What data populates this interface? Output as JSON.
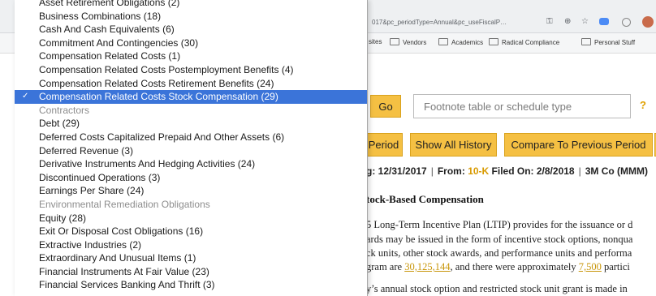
{
  "browser": {
    "url_fragment": "017&pc_periodType=Annual&pc_useFiscalP…",
    "bookmarks": [
      {
        "label": "sites",
        "folder": false
      },
      {
        "label": "Vendors",
        "folder": true
      },
      {
        "label": "Academics",
        "folder": true
      },
      {
        "label": "Radical Compliance",
        "folder": true
      },
      {
        "label": "Personal Stuff",
        "folder": true
      }
    ]
  },
  "search": {
    "go_label": "Go",
    "placeholder": "Footnote table or schedule type",
    "help_label": "?"
  },
  "period_buttons": {
    "period": "Period",
    "show_all_history": "Show All History",
    "compare": "Compare To Previous Period"
  },
  "filing": {
    "date_fragment": "g: 12/31/2017",
    "from_label": "From:",
    "form": "10-K",
    "filed_label": "Filed On: 2/8/2018",
    "company": "3M Co (MMM)"
  },
  "document": {
    "heading": "tock-Based Compensation",
    "line1": "5 Long-Term Incentive Plan (LTIP) provides for the issuance or d",
    "line2": "ards may be issued in the form of incentive stock options, nonqua",
    "line3": "ck units, other stock awards, and performance units and performa",
    "line4_pre": "gram are ",
    "line4_link1": "30,125,144",
    "line4_mid": ", and there were approximately ",
    "line4_link2": "7,500",
    "line4_post": " partici",
    "line5": "y’s annual stock option and restricted stock unit grant is made in"
  },
  "dropdown": {
    "options": [
      {
        "label": "Asset Retirement Obligations (2)",
        "state": "normal"
      },
      {
        "label": "Business Combinations (18)",
        "state": "normal"
      },
      {
        "label": "Cash And Cash Equivalents (6)",
        "state": "normal"
      },
      {
        "label": "Commitment And Contingencies (30)",
        "state": "normal"
      },
      {
        "label": "Compensation Related Costs (1)",
        "state": "normal"
      },
      {
        "label": "Compensation Related Costs Postemployment Benefits (4)",
        "state": "normal"
      },
      {
        "label": "Compensation Related Costs Retirement Benefits (24)",
        "state": "normal"
      },
      {
        "label": "Compensation Related Costs Stock Compensation (29)",
        "state": "selected"
      },
      {
        "label": "Contractors",
        "state": "disabled"
      },
      {
        "label": "Debt (29)",
        "state": "normal"
      },
      {
        "label": "Deferred Costs Capitalized Prepaid And Other Assets (6)",
        "state": "normal"
      },
      {
        "label": "Deferred Revenue (3)",
        "state": "normal"
      },
      {
        "label": "Derivative Instruments And Hedging Activities (24)",
        "state": "normal"
      },
      {
        "label": "Discontinued Operations (3)",
        "state": "normal"
      },
      {
        "label": "Earnings Per Share (24)",
        "state": "normal"
      },
      {
        "label": "Environmental Remediation Obligations",
        "state": "disabled"
      },
      {
        "label": "Equity (28)",
        "state": "normal"
      },
      {
        "label": "Exit Or Disposal Cost Obligations (16)",
        "state": "normal"
      },
      {
        "label": "Extractive Industries (2)",
        "state": "normal"
      },
      {
        "label": "Extraordinary And Unusual Items (1)",
        "state": "normal"
      },
      {
        "label": "Financial Instruments At Fair Value (23)",
        "state": "normal"
      },
      {
        "label": "Financial Services Banking And Thrift (3)",
        "state": "normal"
      }
    ],
    "check_glyph": "✓"
  },
  "colors": {
    "accent_yellow": "#f5c043",
    "selection_blue": "#3b74d9",
    "link_gold": "#c8960a"
  }
}
